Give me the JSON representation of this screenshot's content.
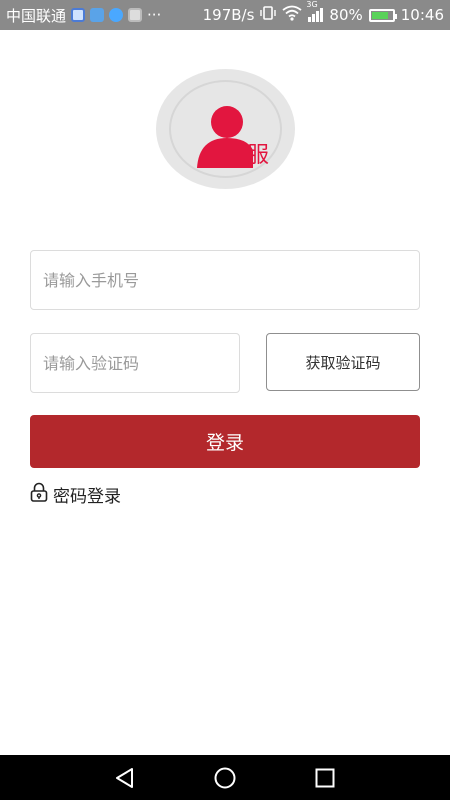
{
  "status_bar": {
    "carrier": "中国联通",
    "dots": "···",
    "speed": "197B/s",
    "battery_percent": "80%",
    "battery_level": 0.8,
    "time": "10:46",
    "network_label": "3G"
  },
  "avatar": {
    "badge_text": "服",
    "accent_color": "#e2163f"
  },
  "form": {
    "phone_placeholder": "请输入手机号",
    "phone_value": "",
    "code_placeholder": "请输入验证码",
    "code_value": "",
    "get_code_label": "获取验证码",
    "login_label": "登录",
    "password_login_label": "密码登录"
  },
  "colors": {
    "primary": "#b3282c",
    "status_bar_bg": "#8a8a8a"
  }
}
